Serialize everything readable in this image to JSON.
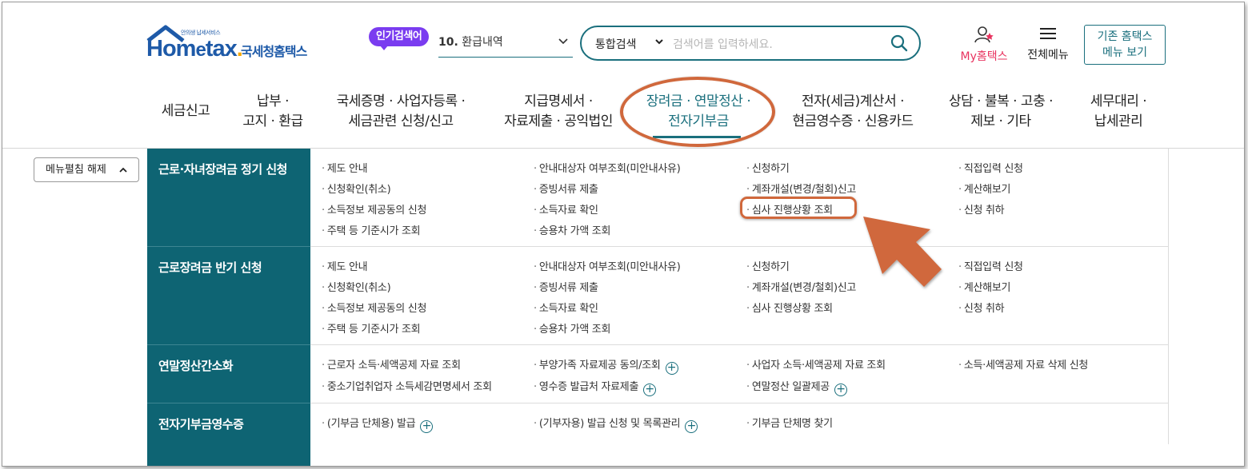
{
  "header": {
    "logo": {
      "tagline": "안의생 납세서비스",
      "brand_main": "Hom",
      "brand_e": "e",
      "brand_tax": "tax",
      "brand_dot": ".",
      "korean_name": "국세청홈택스"
    },
    "popular": {
      "badge": "인기검색어",
      "rank": "10.",
      "term": "환급내역"
    },
    "search": {
      "scope": "통합검색",
      "placeholder": "검색어를 입력하세요."
    },
    "my_hometax": "My홈택스",
    "all_menu": "전체메뉴",
    "legacy_line1": "기존 홈택스",
    "legacy_line2": "메뉴 보기"
  },
  "gnb": [
    {
      "line1": "세금신고",
      "line2": ""
    },
    {
      "line1": "납부 ·",
      "line2": "고지 · 환급"
    },
    {
      "line1": "국세증명 · 사업자등록 ·",
      "line2": "세금관련 신청/신고"
    },
    {
      "line1": "지급명세서 ·",
      "line2": "자료제출 · 공익법인"
    },
    {
      "line1": "장려금 · 연말정산 ·",
      "line2": "전자기부금"
    },
    {
      "line1": "전자(세금)계산서 ·",
      "line2": "현금영수증 · 신용카드"
    },
    {
      "line1": "상담 · 불복 · 고충 ·",
      "line2": "제보 · 기타"
    },
    {
      "line1": "세무대리 ·",
      "line2": "납세관리"
    }
  ],
  "fold_button": "메뉴펼침 해제",
  "categories": [
    {
      "title": "근로·자녀장려금 정기 신청",
      "links": [
        "제도 안내",
        "안내대상자 여부조회(미안내사유)",
        "신청하기",
        "직접입력 신청",
        "신청확인(취소)",
        "증빙서류 제출",
        "계좌개설(변경/철회)신고",
        "계산해보기",
        "소득정보 제공동의 신청",
        "소득자료 확인",
        "심사 진행상황 조회",
        "신청 취하",
        "주택 등 기준시가 조회",
        "승용차 가액 조회"
      ]
    },
    {
      "title": "근로장려금 반기 신청",
      "links": [
        "제도 안내",
        "안내대상자 여부조회(미안내사유)",
        "신청하기",
        "직접입력 신청",
        "신청확인(취소)",
        "증빙서류 제출",
        "계좌개설(변경/철회)신고",
        "계산해보기",
        "소득정보 제공동의 신청",
        "소득자료 확인",
        "심사 진행상황 조회",
        "신청 취하",
        "주택 등 기준시가 조회",
        "승용차 가액 조회"
      ]
    },
    {
      "title": "연말정산간소화",
      "links": [
        "근로자 소득·세액공제 자료 조회",
        "부양가족 자료제공 동의/조회",
        "사업자 소득·세액공제 자료 조회",
        "소득·세액공제 자료 삭제 신청",
        "중소기업취업자 소득세감면명세서 조회",
        "영수증 발급처 자료제출",
        "연말정산 일괄제공"
      ]
    },
    {
      "title": "전자기부금영수증",
      "links": [
        "(기부금 단체용) 발급",
        "(기부자용) 발급 신청 및 목록관리",
        "기부금 단체명 찾기"
      ]
    }
  ],
  "colors": {
    "teal": "#0e6473",
    "accent": "#1a6f7d",
    "annotation": "#d0683c",
    "my": "#e8335f",
    "badge": "#7a3cf0"
  }
}
